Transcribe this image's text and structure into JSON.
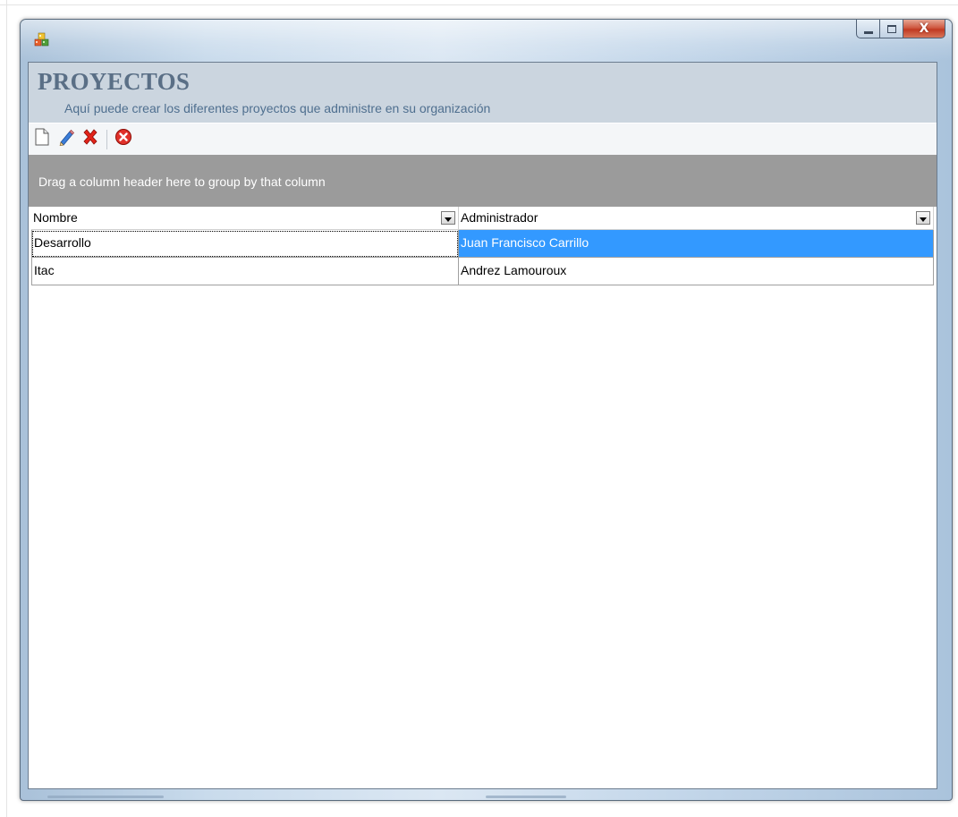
{
  "window": {
    "app_icon": "colorful-cubes-icon",
    "controls": {
      "minimize_icon": "minimize-icon",
      "maximize_icon": "maximize-icon",
      "close_label": "X"
    }
  },
  "header": {
    "title": "PROYECTOS",
    "subtitle": "Aquí puede crear los diferentes proyectos que administre en su organización"
  },
  "toolbar": {
    "buttons": [
      {
        "icon": "new-document-icon"
      },
      {
        "icon": "edit-pencil-icon"
      },
      {
        "icon": "delete-x-icon"
      },
      {
        "icon": "close-circle-icon"
      }
    ]
  },
  "group_panel": {
    "text": "Drag a column header here to group by that column"
  },
  "grid": {
    "columns": [
      "Nombre",
      "Administrador"
    ],
    "rows": [
      [
        "Desarrollo",
        "Juan Francisco Carrillo"
      ],
      [
        "Itac",
        "Andrez Lamouroux"
      ]
    ],
    "selected_row": 0
  },
  "colors": {
    "title": "#5a6f86",
    "header_band": "#cbd5df",
    "group_panel": "#9b9b9b",
    "selection": "#3399ff"
  }
}
